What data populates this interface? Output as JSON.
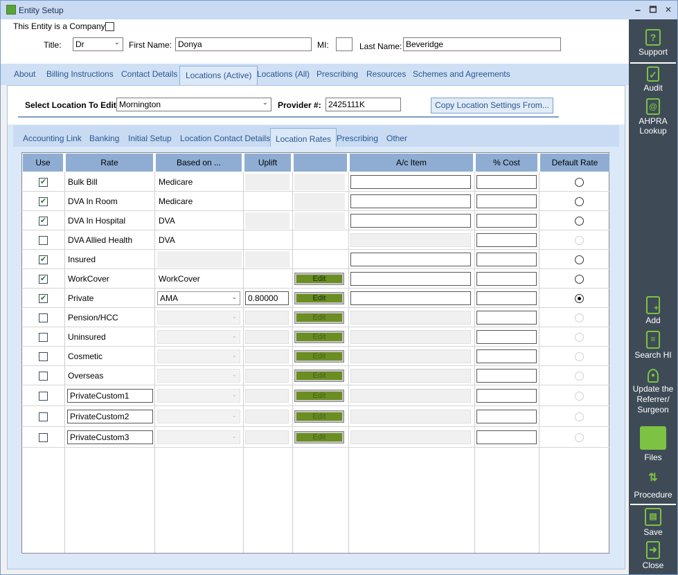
{
  "window": {
    "title": "Entity Setup",
    "minimize": "🗕",
    "maximize": "🗖",
    "close": "✕"
  },
  "entity": {
    "company_label": "This Entity is a Company",
    "title_label": "Title:",
    "title_value": "Dr",
    "first_name_label": "First Name:",
    "first_name_value": "Donya",
    "mi_label": "MI:",
    "mi_value": "",
    "last_name_label": "Last Name:",
    "last_name_value": "Beveridge"
  },
  "main_tabs": [
    "About",
    "Billing Instructions",
    "Contact Details",
    "Locations (Active)",
    "Locations (All)",
    "Prescribing",
    "Resources",
    "Schemes and Agreements"
  ],
  "location": {
    "select_label": "Select Location To Edit:",
    "select_value": "Mornington",
    "provider_label": "Provider #:",
    "provider_value": "2425111K",
    "copy_button": "Copy Location Settings From..."
  },
  "sub_tabs": [
    "Accounting Link",
    "Banking",
    "Initial Setup",
    "Location Contact Details",
    "Location Rates",
    "Prescribing",
    "Other"
  ],
  "grid": {
    "headers": [
      "Use",
      "Rate",
      "Based on ...",
      "Uplift",
      "",
      "A/c Item",
      "% Cost",
      "Default Rate"
    ],
    "edit_label": "Edit",
    "rows": [
      {
        "use": true,
        "rate": "Bulk Bill",
        "based_on": "Medicare"
      },
      {
        "use": true,
        "rate": "DVA In Room",
        "based_on": "Medicare"
      },
      {
        "use": true,
        "rate": "DVA In Hospital",
        "based_on": "DVA"
      },
      {
        "use": false,
        "rate": "DVA Allied Health",
        "based_on": "DVA"
      },
      {
        "use": true,
        "rate": "Insured",
        "based_on": ""
      },
      {
        "use": true,
        "rate": "WorkCover",
        "based_on": "WorkCover"
      },
      {
        "use": true,
        "rate": "Private",
        "based_on": "AMA",
        "uplift": "0.80000",
        "default": true
      },
      {
        "use": false,
        "rate": "Pension/HCC",
        "based_on": ""
      },
      {
        "use": false,
        "rate": "Uninsured",
        "based_on": ""
      },
      {
        "use": false,
        "rate": "Cosmetic",
        "based_on": ""
      },
      {
        "use": false,
        "rate": "Overseas",
        "based_on": ""
      },
      {
        "use": false,
        "rate": "PrivateCustom1",
        "based_on": ""
      },
      {
        "use": false,
        "rate": "PrivateCustom2",
        "based_on": ""
      },
      {
        "use": false,
        "rate": "PrivateCustom3",
        "based_on": ""
      }
    ]
  },
  "sidebar": {
    "support": "Support",
    "audit": "Audit",
    "ahpra": "AHPRA Lookup",
    "add": "Add",
    "search_hi": "Search HI",
    "update": "Update the Referrer/ Surgeon",
    "files": "Files",
    "procedure": "Procedure",
    "save": "Save",
    "close": "Close"
  },
  "colors": {
    "accent": "#7dc242",
    "sidebar": "#3e4b57",
    "header": "#8fadd3",
    "edit": "#6b8e23"
  }
}
